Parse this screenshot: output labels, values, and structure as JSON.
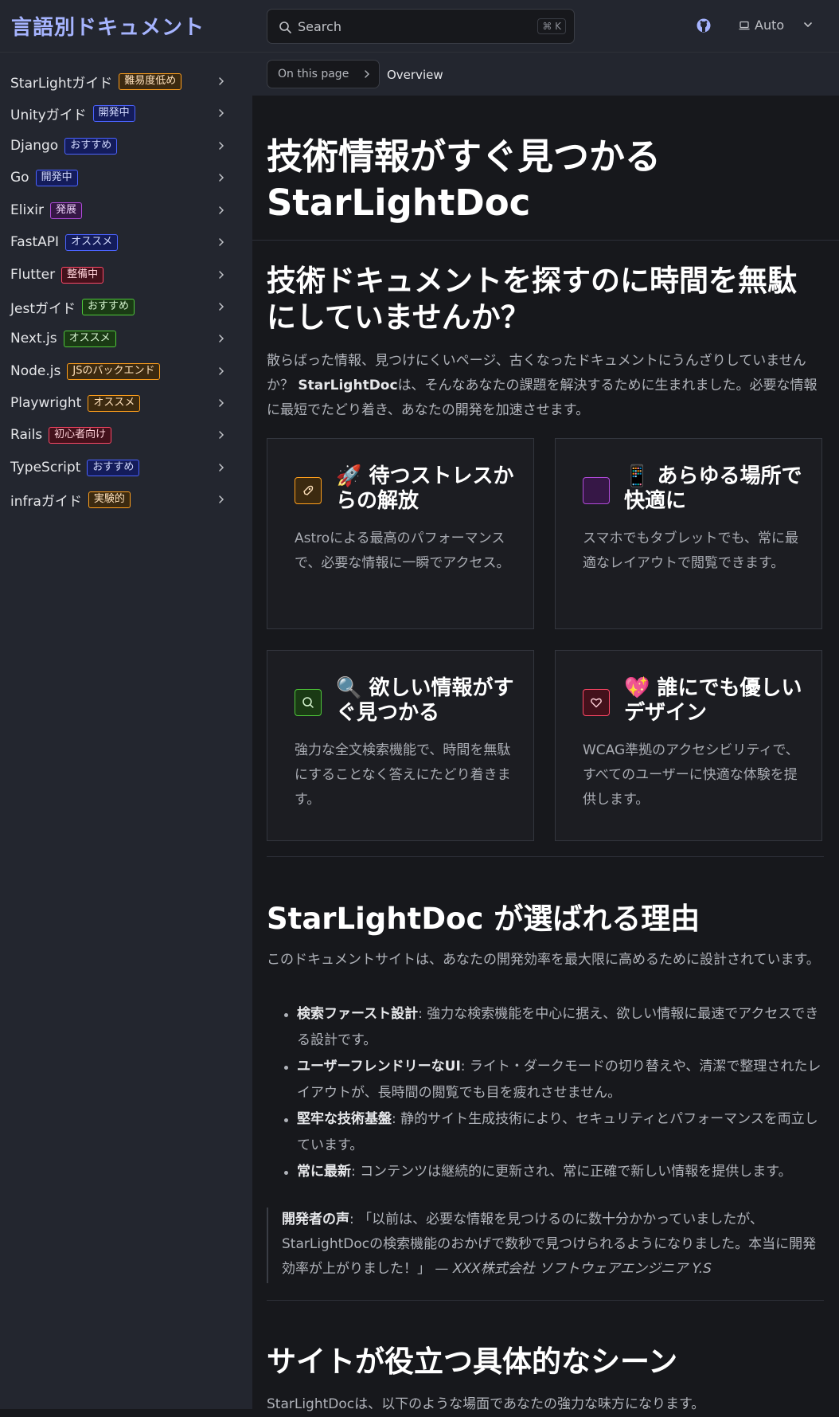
{
  "header": {
    "site_title": "言語別ドキュメント",
    "search_placeholder": "Search",
    "search_shortcut": "⌘ K",
    "theme_label": "Auto"
  },
  "sidebar": {
    "items": [
      {
        "label": "StarLightガイド",
        "badge": "難易度低め",
        "badge_variant": "orange"
      },
      {
        "label": "Unityガイド",
        "badge": "開発中",
        "badge_variant": "blue"
      },
      {
        "label": "Django",
        "badge": "おすすめ",
        "badge_variant": "blue"
      },
      {
        "label": "Go",
        "badge": "開発中",
        "badge_variant": "blue"
      },
      {
        "label": "Elixir",
        "badge": "発展",
        "badge_variant": "purple"
      },
      {
        "label": "FastAPI",
        "badge": "オススメ",
        "badge_variant": "blue"
      },
      {
        "label": "Flutter",
        "badge": "整備中",
        "badge_variant": "red"
      },
      {
        "label": "Jestガイド",
        "badge": "おすすめ",
        "badge_variant": "green"
      },
      {
        "label": "Next.js",
        "badge": "オススメ",
        "badge_variant": "green"
      },
      {
        "label": "Node.js",
        "badge": "JSのバックエンド",
        "badge_variant": "orange"
      },
      {
        "label": "Playwright",
        "badge": "オススメ",
        "badge_variant": "orange"
      },
      {
        "label": "Rails",
        "badge": "初心者向け",
        "badge_variant": "red"
      },
      {
        "label": "TypeScript",
        "badge": "おすすめ",
        "badge_variant": "blue"
      },
      {
        "label": "infraガイド",
        "badge": "実験的",
        "badge_variant": "orange"
      }
    ]
  },
  "toc": {
    "button_label": "On this page",
    "current": "Overview"
  },
  "main": {
    "hero_line1": "技術情報がすぐ見つかる",
    "hero_line2": "StarLightDoc",
    "section1": {
      "heading": "技術ドキュメントを探すのに時間を無駄にしていませんか？",
      "intro_before": "散らばった情報、見つけにくいページ、古くなったドキュメントにうんざりしていませんか？ ",
      "intro_bold": "StarLightDoc",
      "intro_after": "は、そんなあなたの課題を解決するために生まれました。必要な情報に最短でたどり着き、あなたの開発を加速させます。"
    },
    "cards": [
      {
        "emoji": "🚀",
        "title": "待つストレスからの解放",
        "body": "Astroによる最高のパフォーマンスで、必要な情報に一瞬でアクセス。",
        "icon": "rocket-icon",
        "color": "#ff9f1c"
      },
      {
        "emoji": "📱",
        "title": "あらゆる場所で快適に",
        "body": "スマホでもタブレットでも、常に最適なレイアウトで閲覧できます。",
        "icon": "device-icon",
        "color": "#b04bd9"
      },
      {
        "emoji": "🔍",
        "title": "欲しい情報がすぐ見つかる",
        "body": "強力な全文検索機能で、時間を無駄にすることなく答えにたどり着きます。",
        "icon": "search-icon",
        "color": "#4fc83a"
      },
      {
        "emoji": "💖",
        "title": "誰にでも優しいデザイン",
        "body": "WCAG準拠のアクセシビリティで、すべてのユーザーに快適な体験を提供します。",
        "icon": "heart-icon",
        "color": "#ff4766"
      }
    ],
    "section2": {
      "heading": "StarLightDoc が選ばれる理由",
      "intro": "このドキュメントサイトは、あなたの開発効率を最大限に高めるために設計されています。",
      "bullets": [
        {
          "bold": "検索ファースト設計",
          "text": ": 強力な検索機能を中心に据え、欲しい情報に最速でアクセスできる設計です。"
        },
        {
          "bold": "ユーザーフレンドリーなUI",
          "text": ": ライト・ダークモードの切り替えや、清潔で整理されたレイアウトが、長時間の閲覧でも目を疲れさせません。"
        },
        {
          "bold": "堅牢な技術基盤",
          "text": ": 静的サイト生成技術により、セキュリティとパフォーマンスを両立しています。"
        },
        {
          "bold": "常に最新",
          "text": ": コンテンツは継続的に更新され、常に正確で新しい情報を提供します。"
        }
      ],
      "quote_bold": "開発者の声",
      "quote_text": ": 「以前は、必要な情報を見つけるのに数十分かかっていましたが、StarLightDocの検索機能のおかげで数秒で見つけられるようになりました。本当に開発効率が上がりました！」 — ",
      "quote_attribution": "XXX株式会社 ソフトウェアエンジニア Y.S"
    },
    "section3": {
      "heading": "サイトが役立つ具体的なシーン",
      "intro": "StarLightDocは、以下のような場面であなたの強力な味方になります。"
    }
  }
}
